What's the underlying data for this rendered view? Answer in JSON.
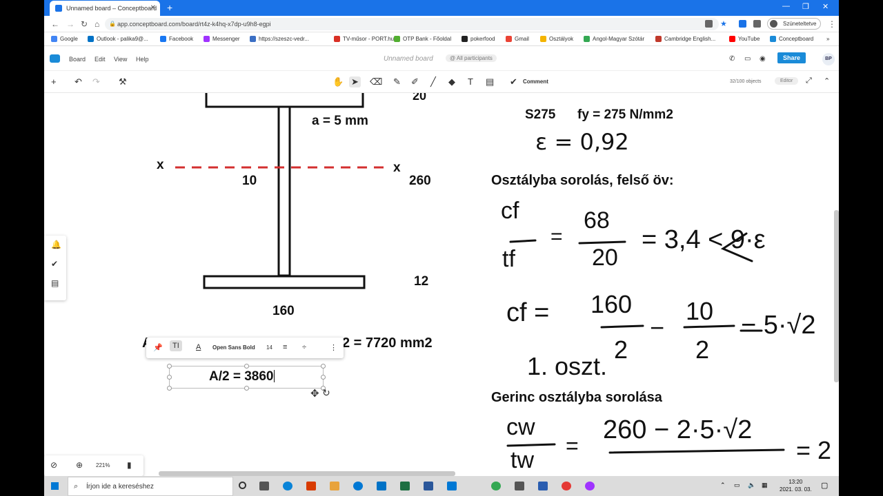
{
  "browser": {
    "tab_title": "Unnamed board – Conceptboard",
    "new_tab": "+",
    "url": "app.conceptboard.com/board/rt4z-k4hq-x7dp-u9h8-egpi",
    "profile_status": "Szüneteltetve",
    "bookmarks": [
      {
        "label": "Google",
        "color": "#4285f4"
      },
      {
        "label": "Outlook - palika9@...",
        "color": "#0072c6"
      },
      {
        "label": "Facebook",
        "color": "#1877f2"
      },
      {
        "label": "Messenger",
        "color": "#a033ff"
      },
      {
        "label": "https://szeszc-vedr...",
        "color": "#3b6fc4"
      },
      {
        "label": "TV-műsor - PORT.hu",
        "color": "#d93025"
      },
      {
        "label": "OTP Bank - Főoldal",
        "color": "#52ae30"
      },
      {
        "label": "pokerfood",
        "color": "#222222"
      },
      {
        "label": "Gmail",
        "color": "#ea4335"
      },
      {
        "label": "Osztályok",
        "color": "#f4b400"
      },
      {
        "label": "Angol-Magyar Szótár",
        "color": "#34a853"
      },
      {
        "label": "Cambridge English...",
        "color": "#c0392b"
      },
      {
        "label": "YouTube",
        "color": "#ff0000"
      },
      {
        "label": "Conceptboard",
        "color": "#1a8bd8"
      }
    ],
    "more_bookmarks": "»"
  },
  "app": {
    "menu": [
      "Board",
      "Edit",
      "View",
      "Help"
    ],
    "board_title": "Unnamed board",
    "participants": "@ All participants",
    "share": "Share",
    "user_initials": "BP",
    "comment": "Comment",
    "object_count": "32/100 objects",
    "role": "Editor"
  },
  "text_toolbar": {
    "font": "Open Sans Bold",
    "size": "14"
  },
  "canvas": {
    "top_dim": "20",
    "weld": "a = 5 mm",
    "x_left": "x",
    "x_right": "x",
    "web_thickness": "10",
    "height": "260",
    "bottom_flange_t": "12",
    "bottom_flange_w": "160",
    "area_left": "A",
    "area_right": "2 = 7720 mm2",
    "edit_text": "A/2 = 3860",
    "steel": "S275",
    "fy": "fy = 275 N/mm2",
    "hw_eps": "ε = 0,92",
    "heading1": "Osztályba sorolás, felső öv:",
    "hw_cf_num": "cf",
    "hw_cf_den": "tf",
    "hw_frac1_num": "68",
    "hw_frac1_den": "20",
    "hw_rest1": "= 3,4 < 9·ε",
    "hw_cf2": "cf =",
    "hw_160": "160",
    "hw_2a": "2",
    "hw_10": "10",
    "hw_2b": "2",
    "hw_rest2": "− 5·√2",
    "hw_class": "1. oszt.",
    "heading2": "Gerinc osztályba sorolása",
    "hw_cw": "cw",
    "hw_tw": "tw",
    "hw_expr": "260 − 2·5·√2",
    "hw_tail": "= 2"
  },
  "zoom": "221%",
  "taskbar": {
    "search_placeholder": "Írjon ide a kereséshez",
    "time": "13:20",
    "date": "2021. 03. 03."
  },
  "colors": {
    "axis_dash": "#d32f2f",
    "brand": "#1a8bd8",
    "chrome": "#1a73e8"
  }
}
